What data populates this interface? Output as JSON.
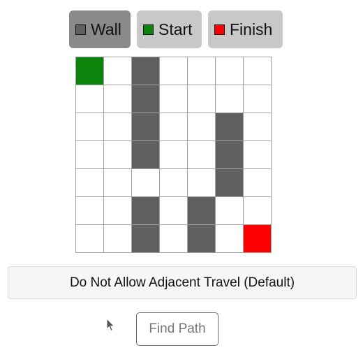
{
  "toolbar": {
    "wall_label": "Wall",
    "start_label": "Start",
    "finish_label": "Finish",
    "selected": "Wall"
  },
  "colors": {
    "wall": "#606060",
    "start": "#0a840a",
    "finish": "#ff0000",
    "empty": "#ffffff",
    "active_tool_bg": "#8a8a8a",
    "tool_bg": "#c8c8c8"
  },
  "grid": {
    "rows": 7,
    "cols": 7,
    "cells": [
      [
        "start",
        "empty",
        "wall",
        "empty",
        "empty",
        "empty",
        "empty"
      ],
      [
        "empty",
        "empty",
        "wall",
        "empty",
        "empty",
        "empty",
        "empty"
      ],
      [
        "empty",
        "empty",
        "wall",
        "empty",
        "empty",
        "wall",
        "empty"
      ],
      [
        "empty",
        "empty",
        "wall",
        "empty",
        "empty",
        "wall",
        "empty"
      ],
      [
        "empty",
        "empty",
        "empty",
        "empty",
        "empty",
        "wall",
        "empty"
      ],
      [
        "empty",
        "empty",
        "wall",
        "empty",
        "wall",
        "empty",
        "empty"
      ],
      [
        "empty",
        "empty",
        "wall",
        "empty",
        "wall",
        "empty",
        "finish"
      ]
    ]
  },
  "adjacent_toggle": {
    "label": "Do Not Allow Adjacent Travel (Default)"
  },
  "find_path": {
    "label": "Find Path"
  },
  "icons": {
    "cursor": "mouse-pointer-icon"
  }
}
